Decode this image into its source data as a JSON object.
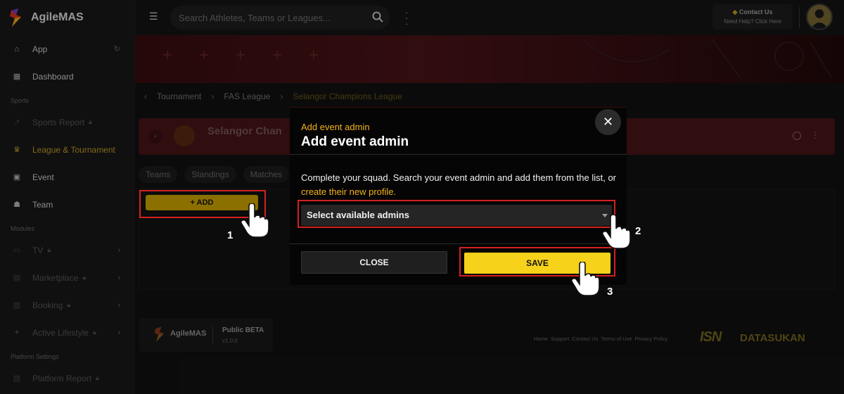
{
  "app": {
    "name": "AgileMAS"
  },
  "sidebar": {
    "items": [
      {
        "label": "App",
        "icon": "home-icon"
      },
      {
        "label": "Dashboard",
        "icon": "grid-icon"
      }
    ],
    "sections": {
      "sports": "Sports",
      "modules": "Modules",
      "platform": "Platform Settings"
    },
    "sports_items": [
      {
        "label": "Sports Report",
        "icon": "trend-icon"
      },
      {
        "label": "League & Tournament",
        "icon": "trophy-icon"
      },
      {
        "label": "Event",
        "icon": "ticket-icon"
      },
      {
        "label": "Team",
        "icon": "team-icon"
      }
    ],
    "module_items": [
      {
        "label": "TV",
        "icon": "tv-icon"
      },
      {
        "label": "Marketplace",
        "icon": "store-icon"
      },
      {
        "label": "Booking",
        "icon": "booking-icon"
      },
      {
        "label": "Active Lifestyle",
        "icon": "run-icon"
      }
    ],
    "platform_items": [
      {
        "label": "Platform Report",
        "icon": "chart-icon"
      }
    ]
  },
  "topbar": {
    "search_placeholder": "Search Athletes, Teams or Leagues...",
    "contact_title": "Contact Us",
    "contact_sub": "Need Help? Click Here"
  },
  "breadcrumb": {
    "items": [
      "Tournament",
      "FAS League",
      "Selangor Champions League"
    ]
  },
  "event": {
    "name": "Selangor Chan"
  },
  "tabs": [
    "Teams",
    "Standings",
    "Matches"
  ],
  "add_button": "+ ADD",
  "steps": [
    "1",
    "2",
    "3"
  ],
  "modal": {
    "subtitle": "Add event admin",
    "title": "Add event admin",
    "desc": "Complete your squad. Search your event admin and add them from the list, or ",
    "desc_link": "create their new profile.",
    "select_value": "Select available admins",
    "close_label": "CLOSE",
    "save_label": "SAVE"
  },
  "footer": {
    "brand": "AgileMAS",
    "beta": "Public BETA",
    "version": "v1.0.0",
    "links": [
      "Home",
      "Support",
      "Contact Us",
      "Terms of Use",
      "Privacy Policy"
    ],
    "partner1": "ISN",
    "partner2": "DATASUKAN"
  },
  "colors": {
    "accent": "#f7d21a",
    "link": "#f2b31e",
    "highlight": "#d42020"
  }
}
